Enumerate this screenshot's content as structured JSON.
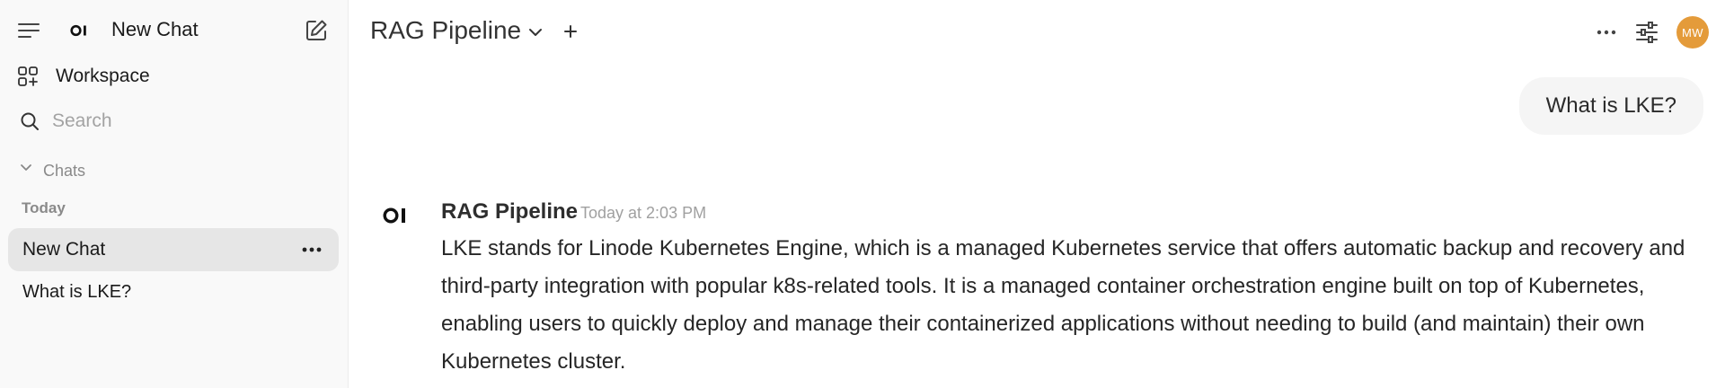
{
  "sidebar": {
    "title": "New Chat",
    "workspace_label": "Workspace",
    "search_placeholder": "Search",
    "chats_section_label": "Chats",
    "group_label": "Today",
    "chats": [
      {
        "label": "New Chat",
        "active": true
      },
      {
        "label": "What is LKE?",
        "active": false
      }
    ],
    "icons": [
      "menu-icon",
      "openwebui-logo",
      "compose-icon",
      "workspace-icon",
      "search-icon",
      "chevron-down-icon",
      "more-horizontal-icon"
    ]
  },
  "header": {
    "model_name": "RAG Pipeline",
    "icons": [
      "chevron-down-icon",
      "plus-icon",
      "more-horizontal-icon",
      "controls-sliders-icon"
    ],
    "avatar_initials": "MW",
    "avatar_color": "#e49b3a"
  },
  "conversation": {
    "user_message": "What is LKE?",
    "assistant": {
      "name": "RAG Pipeline",
      "timestamp": "Today at 2:03 PM",
      "message": "LKE stands for Linode Kubernetes Engine, which is a managed Kubernetes service that offers automatic backup and recovery and third-party integration with popular k8s-related tools. It is a managed container orchestration engine built on top of Kubernetes, enabling users to quickly deploy and manage their containerized applications without needing to build (and maintain) their own Kubernetes cluster."
    }
  }
}
